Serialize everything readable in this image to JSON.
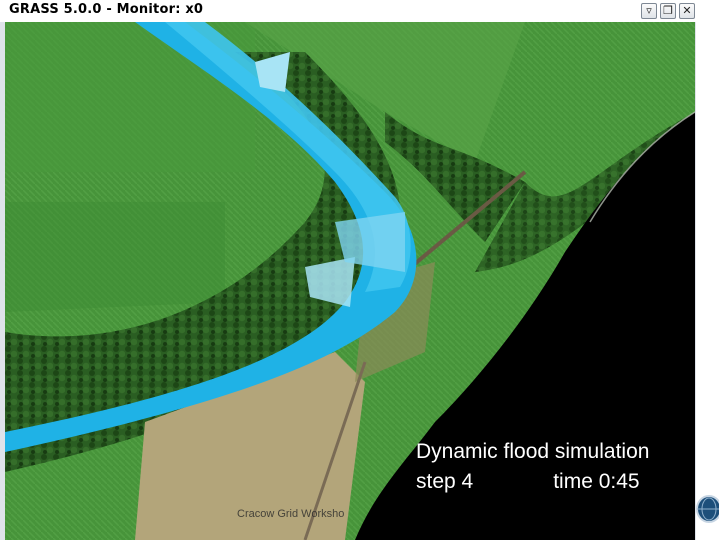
{
  "window": {
    "title": "GRASS 5.0.0 - Monitor: x0",
    "controls": {
      "minimize_icon": "chevron-down-icon",
      "maximize_icon": "maximize-icon",
      "close_icon": "close-icon"
    }
  },
  "map": {
    "caption_line1": "Dynamic flood simulation",
    "step_label": "step 4",
    "time_label": "time 0:45",
    "colors": {
      "flood_deep": "#1fb2e6",
      "flood_shallow": "#a8e4f5",
      "field": "#3f8a32",
      "forest": "#23561d",
      "no_data": "#000000"
    }
  },
  "footer": {
    "text": "Cracow Grid Worksho"
  }
}
